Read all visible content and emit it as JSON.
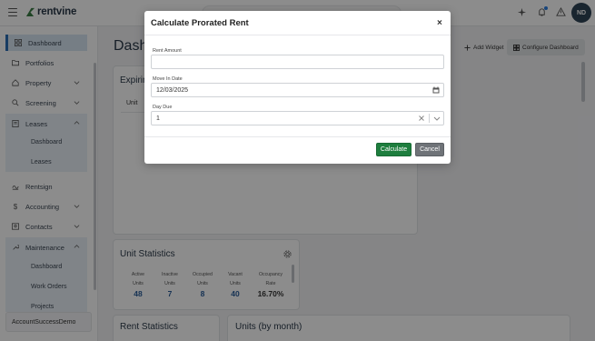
{
  "app": {
    "brand": "rentvine",
    "avatar_initials": "ND"
  },
  "sidebar": {
    "items": [
      {
        "label": "Dashboard",
        "icon": "grid-icon"
      },
      {
        "label": "Portfolios",
        "icon": "folder-icon"
      },
      {
        "label": "Property",
        "icon": "house-icon"
      },
      {
        "label": "Screening",
        "icon": "screening-icon"
      },
      {
        "label": "Leases",
        "icon": "lease-icon"
      },
      {
        "label": "Rentsign",
        "icon": "signature-icon"
      },
      {
        "label": "Accounting",
        "icon": "dollar-icon"
      },
      {
        "label": "Contacts",
        "icon": "contacts-icon"
      },
      {
        "label": "Maintenance",
        "icon": "wrench-icon"
      }
    ],
    "leases_sub": [
      "Dashboard",
      "Leases"
    ],
    "maintenance_sub": [
      "Dashboard",
      "Work Orders",
      "Projects"
    ],
    "account": "AccountSuccessDemo"
  },
  "main": {
    "title": "Dashb",
    "add_widget": "Add Widget",
    "configure": "Configure Dashboard",
    "expiring_title": "Expirin",
    "expiring_col": "Unit",
    "unit_stats": {
      "title": "Unit Statistics",
      "stats": [
        {
          "l1": "Active",
          "l2": "Units",
          "value": "48"
        },
        {
          "l1": "Inactive",
          "l2": "Units",
          "value": "7"
        },
        {
          "l1": "Occupied",
          "l2": "Units",
          "value": "8"
        },
        {
          "l1": "Vacant",
          "l2": "Units",
          "value": "40"
        },
        {
          "l1": "Occupancy",
          "l2": "Rate",
          "value": "16.70%"
        }
      ]
    },
    "rent_stats_title": "Rent Statistics",
    "units_month_title": "Units (by month)"
  },
  "modal": {
    "title": "Calculate Prorated Rent",
    "close": "×",
    "rent_amount_label": "Rent Amount",
    "rent_amount_value": "",
    "move_in_label": "Move In Date",
    "move_in_value": "12/03/2025",
    "day_due_label": "Day Due",
    "day_due_value": "1",
    "calculate": "Calculate",
    "cancel": "Cancel"
  },
  "colors": {
    "primary_green": "#1e7e3e",
    "accent_blue": "#2a6db5",
    "overlay": "rgba(0,0,0,0.45)"
  }
}
